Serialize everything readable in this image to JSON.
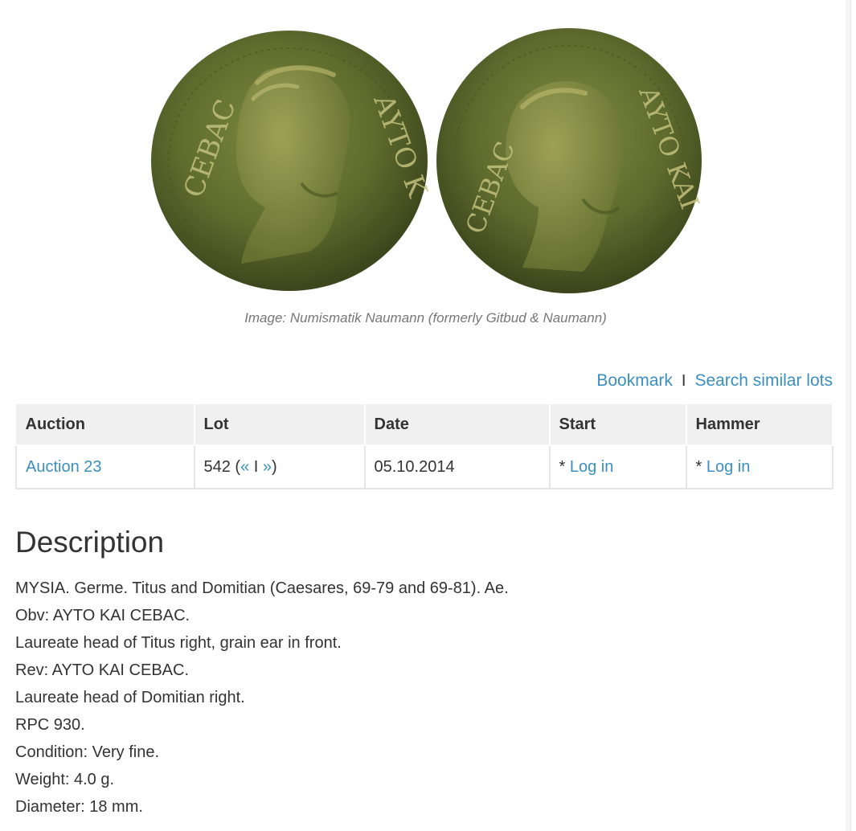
{
  "image": {
    "caption": "Image: Numismatik Naumann (formerly Gitbud & Naumann)",
    "obverse_legend_left": "CEBAC",
    "obverse_legend_right": "AYTO K",
    "reverse_legend_left": "CEBAC",
    "reverse_legend_right": "AYTO KAI"
  },
  "actions": {
    "bookmark": "Bookmark",
    "separator": "I",
    "search_similar": "Search similar lots"
  },
  "table": {
    "headers": {
      "auction": "Auction",
      "lot": "Lot",
      "date": "Date",
      "start": "Start",
      "hammer": "Hammer"
    },
    "row": {
      "auction": "Auction 23",
      "lot_number": "542",
      "lot_open": " (",
      "prev": "«",
      "nav_sep": " I ",
      "next": "»",
      "lot_close": ")",
      "date": "05.10.2014",
      "start_prefix": "* ",
      "start_link": "Log in",
      "hammer_prefix": "* ",
      "hammer_link": "Log in"
    }
  },
  "description": {
    "title": "Description",
    "lines": [
      "MYSIA. Germe. Titus and Domitian (Caesares, 69-79 and 69-81). Ae.",
      "Obv: AYTO KAI CEBAC.",
      "Laureate head of Titus right, grain ear in front.",
      "Rev: AYTO KAI CEBAC.",
      "Laureate head of Domitian right.",
      "RPC 930.",
      "Condition: Very fine.",
      "Weight: 4.0 g.",
      "Diameter: 18 mm."
    ]
  },
  "colors": {
    "link": "#3b8fbf",
    "text": "#333333",
    "caption": "#777777",
    "table_header_bg": "#f0f0f0",
    "coin_patina": "#5c6a2c"
  }
}
